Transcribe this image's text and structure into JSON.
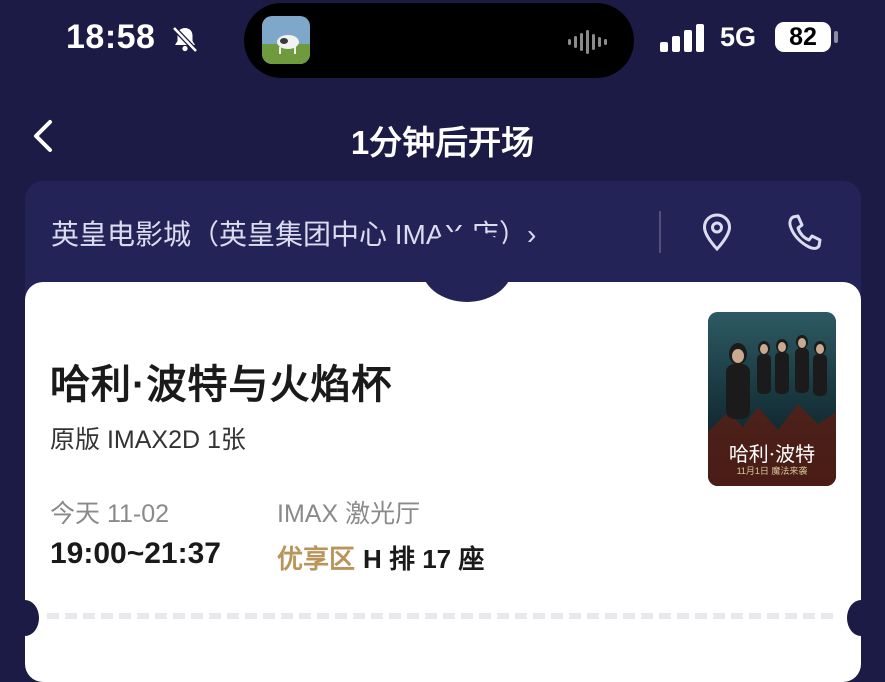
{
  "status_bar": {
    "time": "18:58",
    "network": "5G",
    "battery": "82"
  },
  "nav": {
    "title": "1分钟后开场"
  },
  "cinema": {
    "name": "英皇电影城（英皇集团中心 IMAX 店）›"
  },
  "ticket": {
    "movie_title": "哈利·波特与火焰杯",
    "format": "原版 IMAX2D 1张",
    "date": "今天 11-02",
    "time": "19:00~21:37",
    "hall": "IMAX 激光厅",
    "zone": "优享区",
    "seat": "H 排 17 座"
  },
  "poster": {
    "title": "哈利·波特",
    "subtitle": "11月1日 魔法来袭"
  },
  "colors": {
    "background": "#1c1b45",
    "header_card": "#242357",
    "zone_gold": "#b8955a"
  },
  "icons": {
    "mute": "bell-slash-icon",
    "back": "chevron-left-icon",
    "location": "location-pin-icon",
    "phone": "phone-icon"
  }
}
